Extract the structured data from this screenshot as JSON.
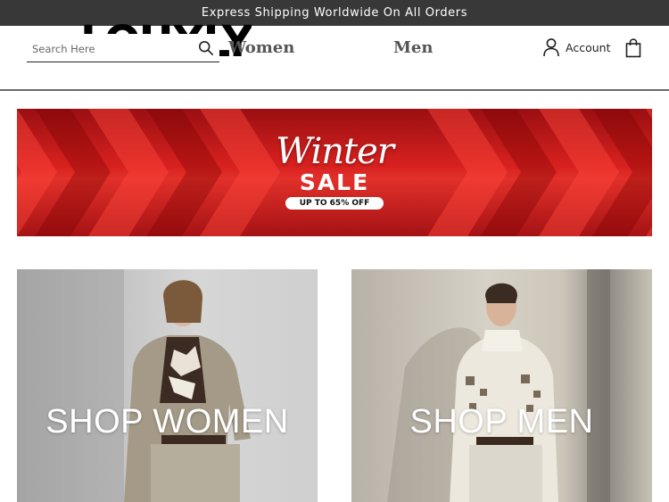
{
  "announcement": "Express Shipping Worldwide On All Orders",
  "header": {
    "logo_text": "LOUXLY",
    "search": {
      "placeholder": "Search Here",
      "value": ""
    },
    "nav": [
      {
        "label": "Women"
      },
      {
        "label": "Men"
      }
    ],
    "account_label": "Account"
  },
  "banner": {
    "title": "Winter",
    "subtitle": "SALE",
    "offer": "UP TO 65% OFF",
    "colors": {
      "base": "#d8211f",
      "dark": "#9a0f12"
    }
  },
  "tiles": [
    {
      "label": "SHOP WOMEN"
    },
    {
      "label": "SHOP MEN"
    }
  ],
  "colors": {
    "topbar": "#383838",
    "nav_text": "#555555"
  }
}
